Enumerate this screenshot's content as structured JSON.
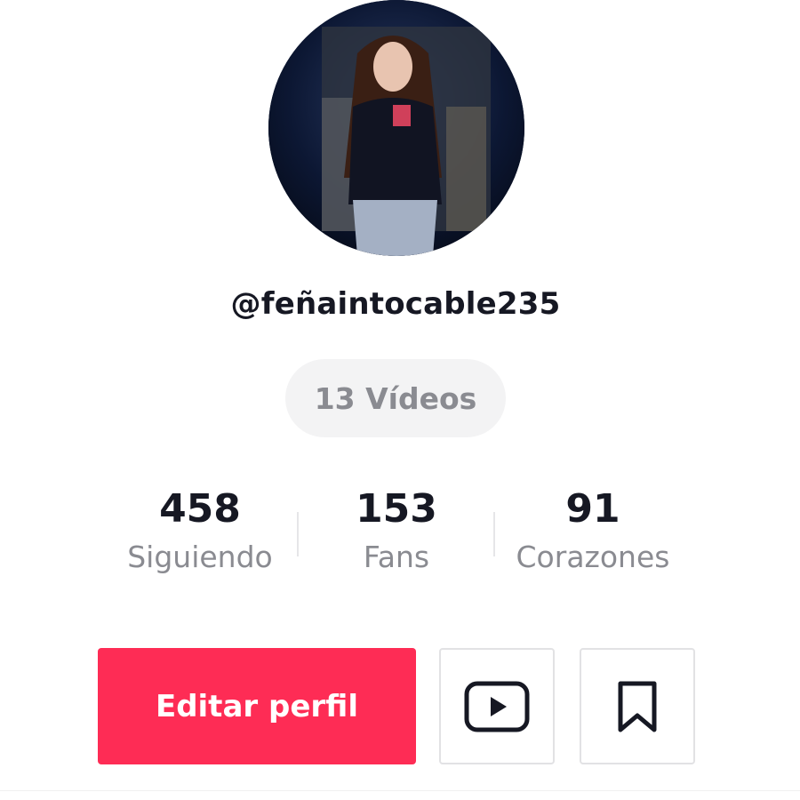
{
  "profile": {
    "username": "@feñaintocable235",
    "videos_label": "13 Vídeos"
  },
  "stats": [
    {
      "value": "458",
      "label": "Siguiendo"
    },
    {
      "value": "153",
      "label": "Fans"
    },
    {
      "value": "91",
      "label": "Corazones"
    }
  ],
  "actions": {
    "edit_profile_label": "Editar perfil",
    "youtube_icon": "youtube-icon",
    "bookmark_icon": "bookmark-icon"
  },
  "colors": {
    "primary": "#fe2c55",
    "text": "#161823",
    "muted": "#8a8b91"
  }
}
